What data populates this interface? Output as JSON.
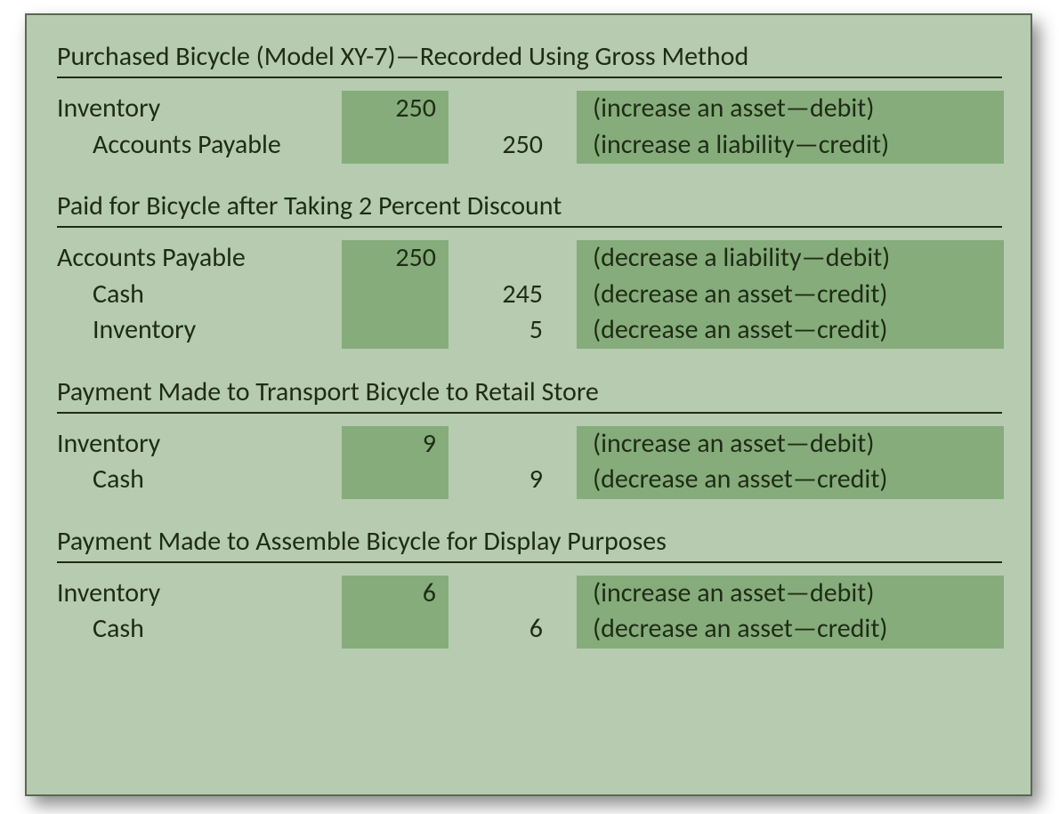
{
  "entries": [
    {
      "title": "Purchased Bicycle (Model XY-7)—Recorded Using Gross Method",
      "lines": [
        {
          "account": "Inventory",
          "debit": "250",
          "credit": "",
          "explain": "(increase an asset—debit)"
        },
        {
          "account": "Accounts Payable",
          "indent": true,
          "debit": "",
          "credit": "250",
          "explain": "(increase a liability—credit)"
        }
      ]
    },
    {
      "title": "Paid for Bicycle after Taking 2 Percent Discount",
      "lines": [
        {
          "account": "Accounts Payable",
          "debit": "250",
          "credit": "",
          "explain": "(decrease a liability—debit)"
        },
        {
          "account": "Cash",
          "indent": true,
          "debit": "",
          "credit": "245",
          "explain": "(decrease an asset—credit)"
        },
        {
          "account": "Inventory",
          "indent": true,
          "debit": "",
          "credit": "5",
          "explain": "(decrease an asset—credit)"
        }
      ]
    },
    {
      "title": "Payment Made to Transport Bicycle to Retail Store",
      "lines": [
        {
          "account": "Inventory",
          "debit": "9",
          "credit": "",
          "explain": "(increase an asset—debit)"
        },
        {
          "account": "Cash",
          "indent": true,
          "debit": "",
          "credit": "9",
          "explain": "(decrease an asset—credit)"
        }
      ]
    },
    {
      "title": "Payment Made to Assemble Bicycle for Display Purposes",
      "lines": [
        {
          "account": "Inventory",
          "debit": "6",
          "credit": "",
          "explain": "(increase an asset—debit)"
        },
        {
          "account": "Cash",
          "indent": true,
          "debit": "",
          "credit": "6",
          "explain": "(decrease an asset—credit)"
        }
      ]
    }
  ]
}
